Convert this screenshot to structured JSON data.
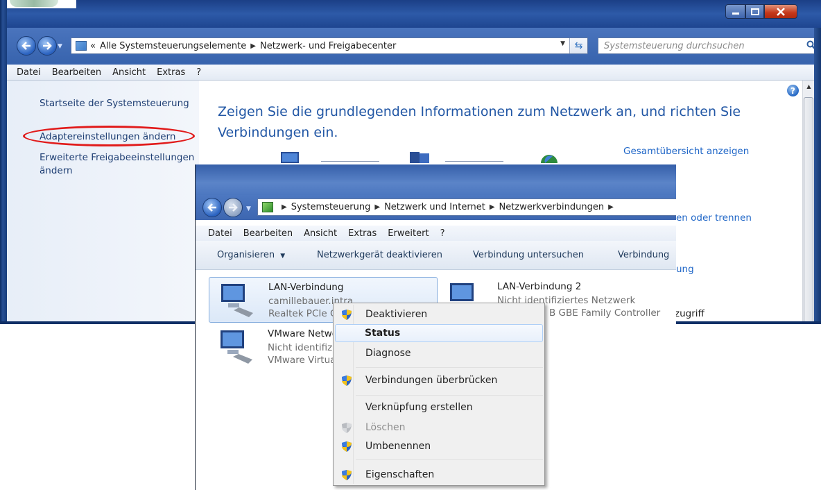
{
  "back_window": {
    "address": {
      "prefix": "«",
      "crumbs": [
        "Alle Systemsteuerungselemente",
        "Netzwerk- und Freigabecenter"
      ]
    },
    "search_placeholder": "Systemsteuerung durchsuchen",
    "menu": [
      "Datei",
      "Bearbeiten",
      "Ansicht",
      "Extras",
      "?"
    ],
    "sidebar": {
      "home": "Startseite der Systemsteuerung",
      "adapter": "Adaptereinstellungen ändern",
      "advanced": "Erweiterte Freigabeeinstellungen ändern"
    },
    "main": {
      "heading": "Zeigen Sie die grundlegenden Informationen zum Netzwerk an, und richten Sie Verbindungen ein.",
      "overview_link": "Gesamtübersicht anzeigen",
      "partial1": "en oder trennen",
      "partial2": "ung",
      "partial3": "zugriff"
    }
  },
  "front_window": {
    "address": {
      "crumbs": [
        "Systemsteuerung",
        "Netzwerk und Internet",
        "Netzwerkverbindungen"
      ]
    },
    "menu": [
      "Datei",
      "Bearbeiten",
      "Ansicht",
      "Extras",
      "Erweitert",
      "?"
    ],
    "toolbar": {
      "organize": "Organisieren",
      "disable": "Netzwerkgerät deaktivieren",
      "diagnose": "Verbindung untersuchen",
      "partial": "Verbindung"
    },
    "connections": [
      {
        "name": "LAN-Verbindung",
        "line1": "camillebauer.intra",
        "line2": "Realtek PCIe G"
      },
      {
        "name": "LAN-Verbindung 2",
        "line1": "Nicht identifiziertes Netzwerk",
        "line2": "B GBE Family Controller"
      },
      {
        "name": "VMware Netwo",
        "line1": "Nicht identifizi",
        "line2": "VMware Virtua"
      }
    ]
  },
  "context_menu": {
    "items": [
      {
        "label": "Deaktivieren",
        "icon": "shield-icon"
      },
      {
        "label": "Status",
        "icon": ""
      },
      {
        "label": "Diagnose",
        "icon": ""
      },
      {
        "label": "Verbindungen überbrücken",
        "icon": "shield-icon"
      },
      {
        "label": "Verknüpfung erstellen",
        "icon": ""
      },
      {
        "label": "Löschen",
        "icon": "shield-icon-disabled"
      },
      {
        "label": "Umbenennen",
        "icon": "shield-icon"
      },
      {
        "label": "Eigenschaften",
        "icon": "shield-icon"
      }
    ]
  }
}
